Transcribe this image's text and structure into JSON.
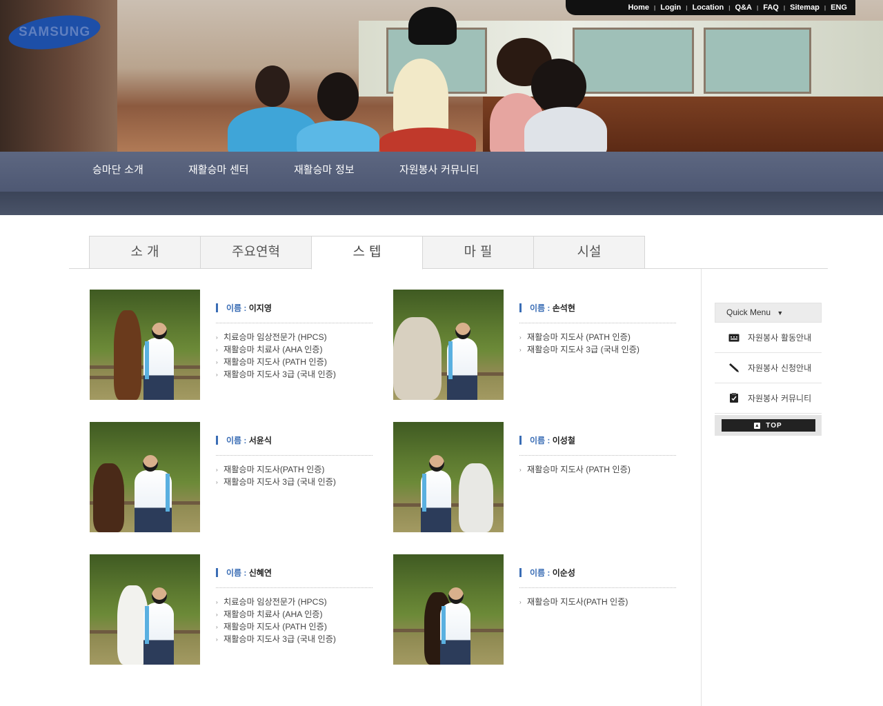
{
  "top_links": [
    "Home",
    "Login",
    "Location",
    "Q&A",
    "FAQ",
    "Sitemap",
    "ENG"
  ],
  "logo_text": "SAMSUNG",
  "main_nav": [
    "승마단 소개",
    "재활승마 센터",
    "재활승마 정보",
    "자원봉사 커뮤니티"
  ],
  "tabs": [
    "소 개",
    "주요연혁",
    "스 텝",
    "마 필",
    "시설"
  ],
  "active_tab": "스 텝",
  "name_label": "이름 : ",
  "staff": [
    {
      "name": "이지영",
      "quals": [
        "치료승마 임상전문가 (HPCS)",
        "재활승마 치료사 (AHA 인증)",
        "재활승마 지도사 (PATH 인증)",
        "재활승마 지도사 3급 (국내 인증)"
      ]
    },
    {
      "name": "손석현",
      "quals": [
        "재활승마 지도사 (PATH 인증)",
        "재활승마 지도사 3급 (국내 인증)"
      ]
    },
    {
      "name": "서윤식",
      "quals": [
        "재활승마 지도사(PATH 인증)",
        "재활승마 지도사 3급 (국내 인증)"
      ]
    },
    {
      "name": "이성철",
      "quals": [
        "재활승마 지도사 (PATH 인증)"
      ]
    },
    {
      "name": "신혜연",
      "quals": [
        "치료승마 임상전문가 (HPCS)",
        "재활승마 치료사 (AHA 인증)",
        "재활승마 지도사 (PATH 인증)",
        "재활승마 지도사 3급 (국내 인증)"
      ]
    },
    {
      "name": "이순성",
      "quals": [
        "재활승마 지도사(PATH 인증)"
      ]
    }
  ],
  "quick_menu": {
    "title": "Quick Menu",
    "items": [
      {
        "label": "자원봉사 활동안내",
        "icon": "keyboard-icon"
      },
      {
        "label": "자원봉사 신청안내",
        "icon": "pen-icon"
      },
      {
        "label": "자원봉사 커뮤니티",
        "icon": "checklist-icon"
      }
    ],
    "top_label": "TOP"
  },
  "colors": {
    "nav_bg": "#56607a",
    "accent_blue": "#3a6db5",
    "logo_blue": "#1d4fa8"
  }
}
